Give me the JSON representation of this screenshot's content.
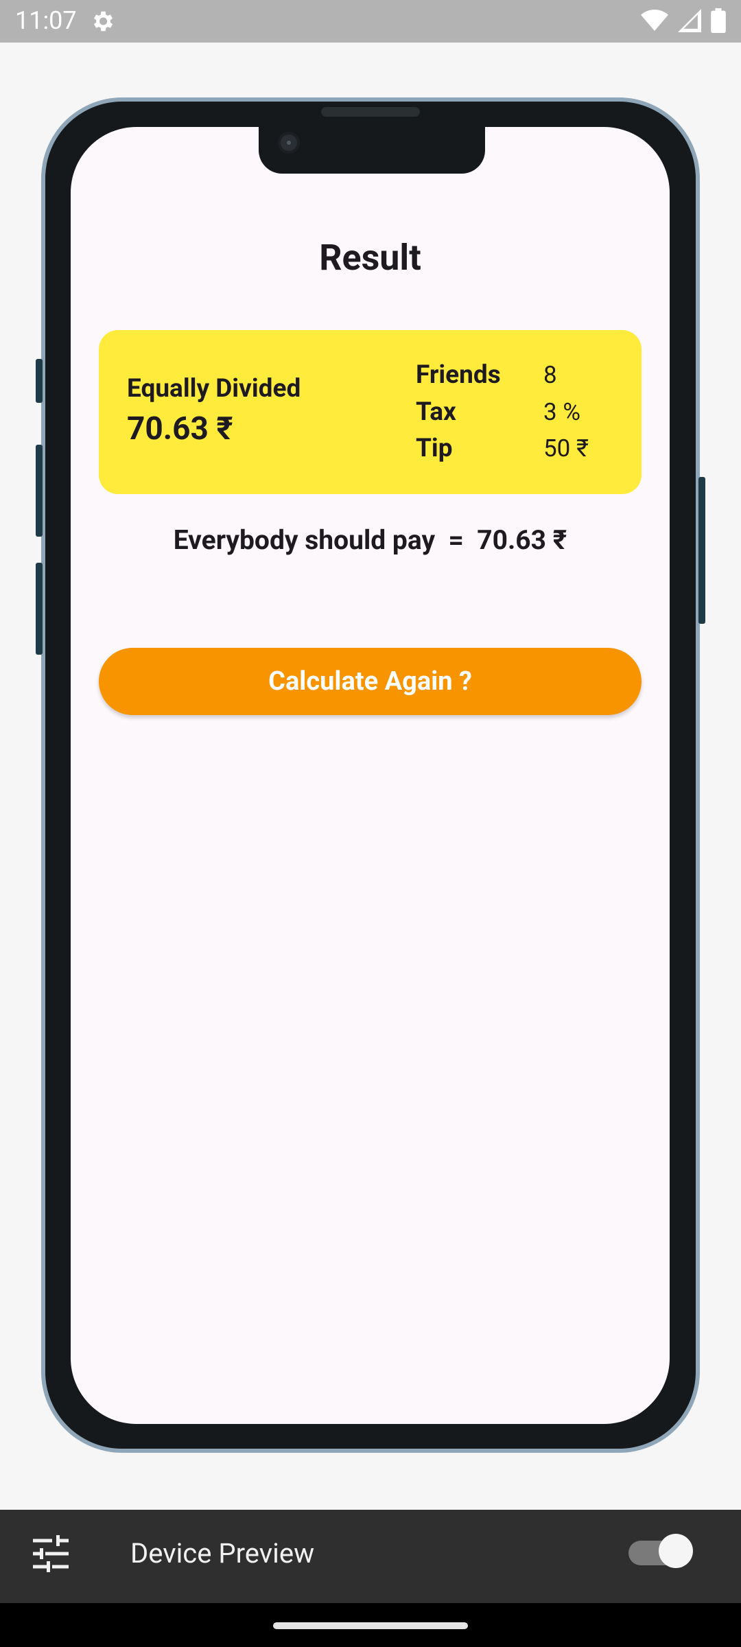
{
  "status_bar": {
    "time": "11:07",
    "icons": [
      "settings-gear-icon",
      "wifi-icon",
      "signal-icon",
      "battery-icon"
    ]
  },
  "result_screen": {
    "title": "Result",
    "summary_card": {
      "equally_divided_label": "Equally Divided",
      "equally_divided_value": "70.63 ₹",
      "details": [
        {
          "label": "Friends",
          "value": "8"
        },
        {
          "label": "Tax",
          "value": "3 %"
        },
        {
          "label": "Tip",
          "value": "50 ₹"
        }
      ],
      "background_color": "#ffeb3b"
    },
    "pay_line": "Everybody should pay  =  70.63 ₹",
    "calculate_button_label": "Calculate Again ?",
    "button_color": "#f79400"
  },
  "device_preview_toolbar": {
    "settings_icon": "sliders-icon",
    "label": "Device Preview",
    "toggle_on": true
  }
}
